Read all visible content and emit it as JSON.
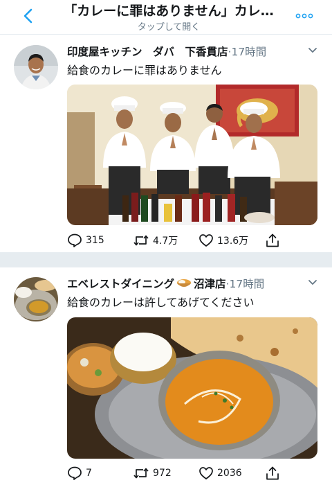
{
  "header": {
    "title": "「カレーに罪はありません」カレ…",
    "subtitle": "タップして開く"
  },
  "tweets": [
    {
      "name": "印度屋キッチン　ダバ　下香貫店",
      "time": "17時間",
      "text": "給食のカレーに罪はありません",
      "replies": "315",
      "retweets": "4.7万",
      "likes": "13.6万"
    },
    {
      "name": "エベレストダイニング",
      "name_suffix": "沼津店",
      "time": "17時間",
      "text": "給食のカレーは許してあげてください",
      "replies": "7",
      "retweets": "972",
      "likes": "2036"
    }
  ],
  "icons": [
    "back-chevron-icon",
    "more-dots-icon",
    "dropdown-chevron-icon",
    "reply-icon",
    "retweet-icon",
    "like-icon",
    "share-icon",
    "curry-bowl-emoji-icon"
  ],
  "colors": {
    "text": "#14171a",
    "secondary": "#657786",
    "accent": "#1da1f2",
    "divider": "#e6ecf0"
  }
}
